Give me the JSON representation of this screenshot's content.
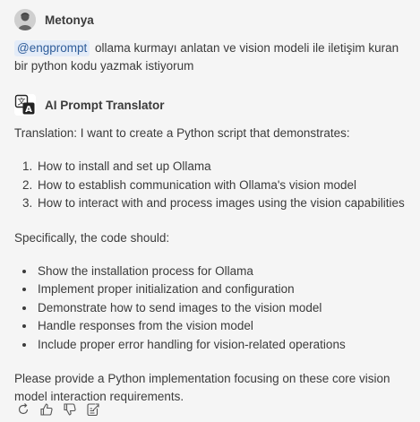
{
  "user_message": {
    "author": "Metonya",
    "mention": "@engprompt",
    "text": " ollama kurmayı anlatan ve vision modeli ile iletişim kuran bir python kodu yazmak istiyorum"
  },
  "bot_message": {
    "author": "AI Prompt Translator",
    "intro": "Translation: I want to create a Python script that demonstrates:",
    "steps": [
      "How to install and set up Ollama",
      "How to establish communication with Ollama's vision model",
      "How to interact with and process images using the vision capabilities"
    ],
    "specifically": "Specifically, the code should:",
    "requirements": [
      "Show the installation process for Ollama",
      "Implement proper initialization and configuration",
      "Demonstrate how to send images to the vision model",
      "Handle responses from the vision model",
      "Include proper error handling for vision-related operations"
    ],
    "closing": "Please provide a Python implementation focusing on these core vision model interaction requirements."
  },
  "actions": [
    {
      "icon": "retry-icon"
    },
    {
      "icon": "thumbs-up-icon"
    },
    {
      "icon": "thumbs-down-icon"
    },
    {
      "icon": "insert-into-editor-icon"
    }
  ]
}
